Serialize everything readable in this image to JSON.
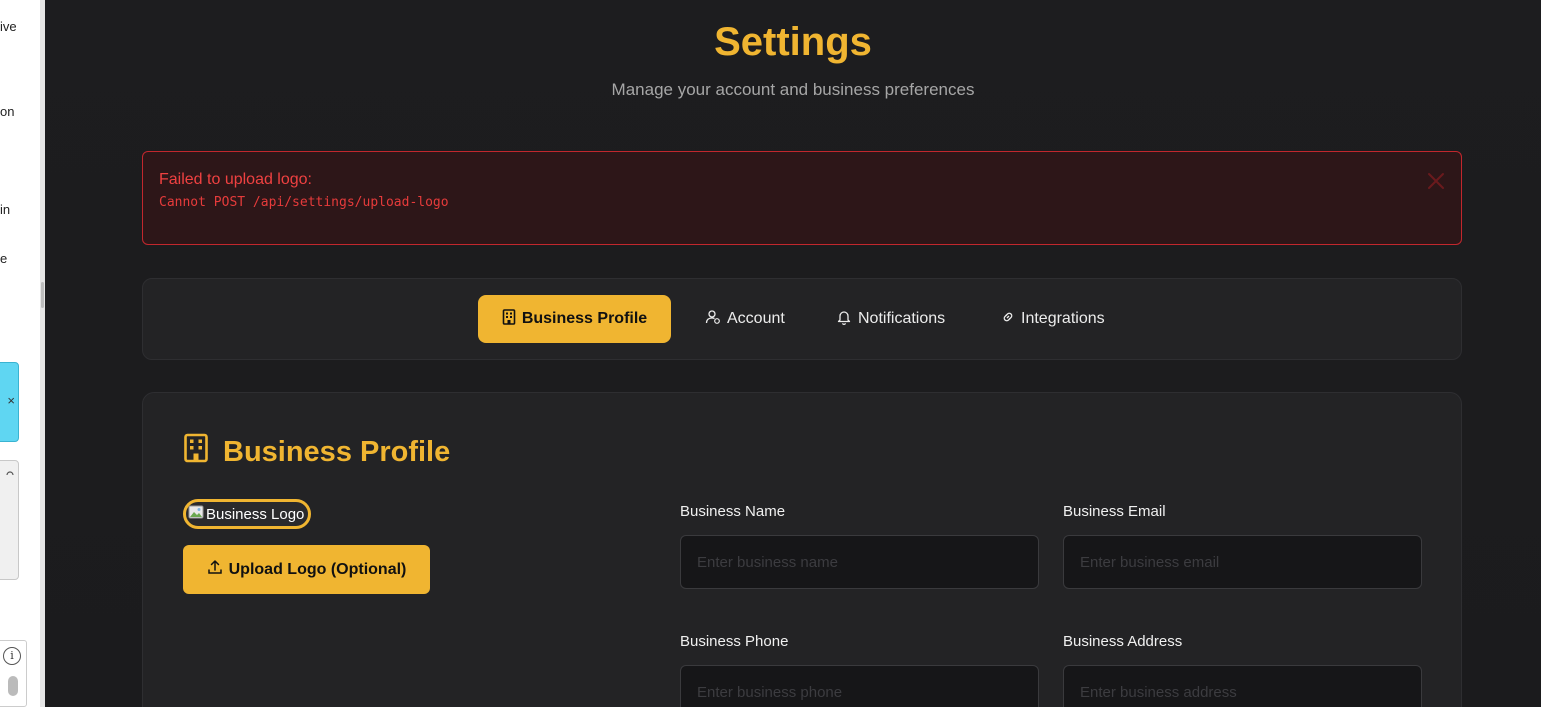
{
  "left_panel": {
    "fragments": [
      "ive",
      "on",
      "in",
      "e"
    ],
    "cyan_glyph": "×",
    "info_glyph": "i"
  },
  "header": {
    "title": "Settings",
    "subtitle": "Manage your account and business preferences"
  },
  "error": {
    "title": "Failed to upload logo:",
    "detail": "Cannot POST /api/settings/upload-logo"
  },
  "tabs": [
    {
      "label": "Business Profile",
      "icon": "building-icon",
      "active": true
    },
    {
      "label": "Account",
      "icon": "user-cog-icon",
      "active": false
    },
    {
      "label": "Notifications",
      "icon": "bell-icon",
      "active": false
    },
    {
      "label": "Integrations",
      "icon": "link-icon",
      "active": false
    }
  ],
  "business_profile": {
    "title": "Business Profile",
    "logo_alt": "Business Logo",
    "upload_label": "Upload Logo (Optional)",
    "fields": {
      "name": {
        "label": "Business Name",
        "placeholder": "Enter business name",
        "value": ""
      },
      "email": {
        "label": "Business Email",
        "placeholder": "Enter business email",
        "value": ""
      },
      "phone": {
        "label": "Business Phone",
        "placeholder": "Enter business phone",
        "value": ""
      },
      "address": {
        "label": "Business Address",
        "placeholder": "Enter business address",
        "value": ""
      }
    }
  },
  "colors": {
    "accent": "#f0b531",
    "background": "#1b1b1d",
    "error": "#ef4141"
  }
}
